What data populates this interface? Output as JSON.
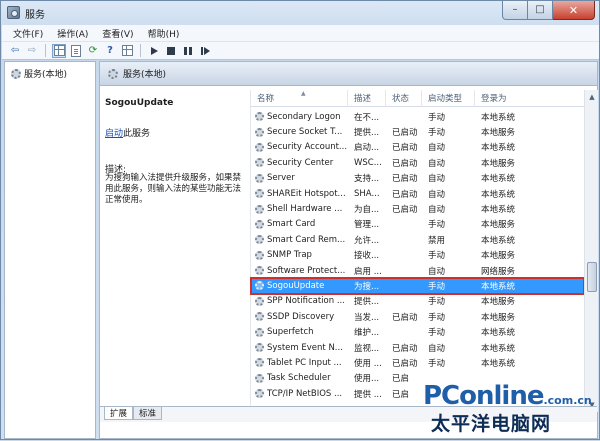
{
  "window": {
    "title": "服务",
    "icon": "services-icon",
    "controls": {
      "minimize": "–",
      "maximize": "□",
      "close": "✕"
    }
  },
  "menu": [
    "文件(F)",
    "操作(A)",
    "查看(V)",
    "帮助(H)"
  ],
  "toolbar": {
    "icons": [
      "back-arrow-icon",
      "forward-arrow-icon",
      "console-tree-icon",
      "properties-icon",
      "refresh-icon",
      "help-icon",
      "play-icon",
      "stop-icon",
      "pause-icon",
      "restart-icon"
    ]
  },
  "tree": {
    "item": "服务(本地)"
  },
  "header": {
    "title": "服务(本地)"
  },
  "details": {
    "service_name": "SogouUpdate",
    "start_link": "启动",
    "start_suffix": "此服务",
    "desc_label": "描述:",
    "desc_text": "为搜狗输入法提供升级服务，如果禁用此服务，则输入法的某些功能无法正常使用。"
  },
  "columns": [
    "名称",
    "描述",
    "状态",
    "启动类型",
    "登录为"
  ],
  "services": [
    {
      "name": "Secondary Logon",
      "desc": "在不...",
      "status": "",
      "startup": "手动",
      "logon": "本地系统"
    },
    {
      "name": "Secure Socket T...",
      "desc": "提供...",
      "status": "已启动",
      "startup": "手动",
      "logon": "本地服务"
    },
    {
      "name": "Security Account...",
      "desc": "启动...",
      "status": "已启动",
      "startup": "自动",
      "logon": "本地系统"
    },
    {
      "name": "Security Center",
      "desc": "WSC...",
      "status": "已启动",
      "startup": "自动",
      "logon": "本地服务"
    },
    {
      "name": "Server",
      "desc": "支持...",
      "status": "已启动",
      "startup": "自动",
      "logon": "本地系统"
    },
    {
      "name": "SHAREit Hotspot...",
      "desc": "SHA...",
      "status": "已启动",
      "startup": "自动",
      "logon": "本地系统"
    },
    {
      "name": "Shell Hardware ...",
      "desc": "为自...",
      "status": "已启动",
      "startup": "自动",
      "logon": "本地系统"
    },
    {
      "name": "Smart Card",
      "desc": "管理...",
      "status": "",
      "startup": "手动",
      "logon": "本地服务"
    },
    {
      "name": "Smart Card Rem...",
      "desc": "允许...",
      "status": "",
      "startup": "禁用",
      "logon": "本地系统"
    },
    {
      "name": "SNMP Trap",
      "desc": "接收...",
      "status": "",
      "startup": "手动",
      "logon": "本地服务"
    },
    {
      "name": "Software Protect...",
      "desc": "启用 ...",
      "status": "",
      "startup": "自动",
      "logon": "网络服务"
    },
    {
      "name": "SogouUpdate",
      "desc": "为搜...",
      "status": "",
      "startup": "手动",
      "logon": "本地系统",
      "selected": true
    },
    {
      "name": "SPP Notification ...",
      "desc": "提供...",
      "status": "",
      "startup": "手动",
      "logon": "本地服务"
    },
    {
      "name": "SSDP Discovery",
      "desc": "当发...",
      "status": "已启动",
      "startup": "手动",
      "logon": "本地服务"
    },
    {
      "name": "Superfetch",
      "desc": "维护...",
      "status": "",
      "startup": "手动",
      "logon": "本地系统"
    },
    {
      "name": "System Event N...",
      "desc": "监视...",
      "status": "已启动",
      "startup": "自动",
      "logon": "本地系统"
    },
    {
      "name": "Tablet PC Input ...",
      "desc": "使用 ...",
      "status": "已启动",
      "startup": "手动",
      "logon": "本地系统"
    },
    {
      "name": "Task Scheduler",
      "desc": "使用...",
      "status": "已启",
      "startup": "",
      "logon": ""
    },
    {
      "name": "TCP/IP NetBIOS ...",
      "desc": "提供 ...",
      "status": "已启",
      "startup": "",
      "logon": ""
    }
  ],
  "tabs": [
    "扩展",
    "标准"
  ],
  "watermark": {
    "brand": "PConline",
    "domain": ".com.cn",
    "cn": "太平洋电脑网"
  },
  "colors": {
    "selection": "#3399ff",
    "highlight_border": "#d0302a",
    "link": "#1a4fb3"
  }
}
